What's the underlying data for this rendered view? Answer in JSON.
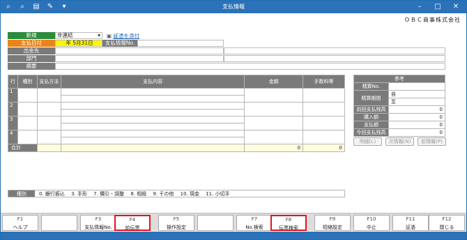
{
  "window": {
    "title": "支払情報",
    "company": "ＯＢＣ商事株式会社"
  },
  "header": {
    "new_label": "新規",
    "new_value": "非連結",
    "attach_label": "証憑を添付",
    "pay_date_label": "支払日付",
    "pay_date_value": "年  5月31日",
    "pay_info_no_label": "支払情報No.",
    "payee_label": "出金先",
    "dept_label": "部門",
    "summary_label": "摘要"
  },
  "table": {
    "headers": [
      "行",
      "種別",
      "支払方法",
      "支払内容",
      "金額",
      "手数料等"
    ],
    "rows": [
      "1",
      "2",
      "3",
      "4"
    ],
    "total_label": "合計",
    "total_amount": "0",
    "total_fee": "0"
  },
  "reference": {
    "title": "参考",
    "items": [
      {
        "label": "精算No.",
        "value": ""
      },
      {
        "label": "精算期間",
        "value": "自"
      },
      {
        "label": "",
        "value": "至"
      },
      {
        "label": "前回支払残高",
        "value": "0"
      },
      {
        "label": "購入額",
        "value": "0"
      },
      {
        "label": "支払額",
        "value": "0"
      },
      {
        "label": "今回支払残高",
        "value": "0"
      }
    ],
    "buttons": [
      "明細(L)",
      "次情報(N)",
      "前情報(P)"
    ]
  },
  "kind_legend": {
    "label": "種別",
    "text": "0. 銀行振込　 3. 手形　 7. 價引・調整　 8. 相殺　 9. その他　 10. 現金　 11. 小切手"
  },
  "fkeys": [
    {
      "num": "F1",
      "label": "ヘルプ"
    },
    {
      "num": "",
      "label": ""
    },
    {
      "num": "F3",
      "label": "支払情報No."
    },
    {
      "num": "F4",
      "label": "前伝票"
    },
    {
      "num": "F5",
      "label": "操作設定"
    },
    {
      "num": "",
      "label": ""
    },
    {
      "num": "F7",
      "label": "No.検索"
    },
    {
      "num": "F8",
      "label": "伝票検索"
    },
    {
      "num": "F9",
      "label": "短縮設定"
    },
    {
      "num": "F10",
      "label": "中止"
    },
    {
      "num": "F11",
      "label": "証憑"
    },
    {
      "num": "F12",
      "label": "閉じる"
    }
  ]
}
